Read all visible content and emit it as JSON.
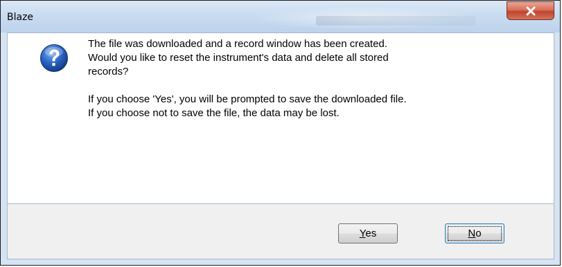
{
  "window": {
    "title": "Blaze",
    "close_glyph": "close-icon"
  },
  "message": {
    "icon": "question-icon",
    "paragraph1": "The file was downloaded and a record window has been created.\nWould you like to reset the instrument's data and delete all stored\nrecords?",
    "paragraph2": "If you choose 'Yes', you will be prompted to save the downloaded file.\nIf you choose not to save the file, the data may be lost."
  },
  "buttons": {
    "yes": {
      "mnemonic": "Y",
      "rest": "es",
      "focused": false
    },
    "no": {
      "mnemonic": "N",
      "rest": "o",
      "focused": true
    }
  },
  "colors": {
    "close_button": "#c0452d",
    "icon_blue": "#2a65c4",
    "focus_border": "#3c7fb1"
  }
}
